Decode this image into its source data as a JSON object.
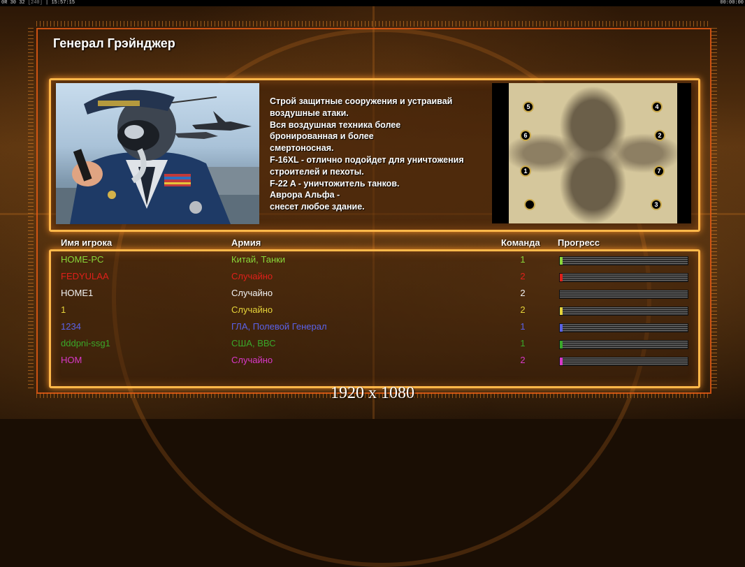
{
  "status_bar": {
    "fps": "0R 30 32",
    "fps_dim": "[240]",
    "clock": "15:57:15",
    "timer": "00:00:00"
  },
  "general_name": "Генерал Грэйнджер",
  "description": [
    "Строй защитные сооружения и устраивай",
    " воздушные атаки.",
    "Вся воздушная техника более",
    " бронированная и более",
    "смертоносная.",
    "F-16XL - отлично подойдет для уничтожения",
    " строителей и пехоты.",
    "F-22 A - уничтожитель танков.",
    "Аврора Альфа -",
    "снесет любое здание."
  ],
  "minimap": {
    "start_positions": [
      "5",
      "4",
      "6",
      "2",
      "1",
      "7",
      "",
      "3"
    ]
  },
  "table": {
    "headers": {
      "player": "Имя игрока",
      "army": "Армия",
      "team": "Команда",
      "progress": "Прогресс"
    },
    "rows": [
      {
        "player": "HOME-PC",
        "army": "Китай, Танки",
        "team": "1",
        "color": "#8ad83a",
        "progress": 0.02
      },
      {
        "player": "FEDYULAA",
        "army": "Случайно",
        "team": "2",
        "color": "#e0201a",
        "progress": 0.02
      },
      {
        "player": "HOME1",
        "army": "Случайно",
        "team": "2",
        "color": "#f2f2f2",
        "progress": 0.0
      },
      {
        "player": "1",
        "army": "Случайно",
        "team": "2",
        "color": "#e6d43a",
        "progress": 0.02
      },
      {
        "player": "1234",
        "army": "ГЛА, Полевой Генерал",
        "team": "1",
        "color": "#5a62e8",
        "progress": 0.02
      },
      {
        "player": "dddpni-ssg1",
        "army": "США, ВВС",
        "team": "1",
        "color": "#3aa82a",
        "progress": 0.02
      },
      {
        "player": "HOM",
        "army": "Случайно",
        "team": "2",
        "color": "#d838c8",
        "progress": 0.02
      }
    ]
  },
  "resolution_label": "1920 x 1080",
  "colors": {
    "frame": "#e65a14",
    "box_glow": "#ffb84a"
  }
}
